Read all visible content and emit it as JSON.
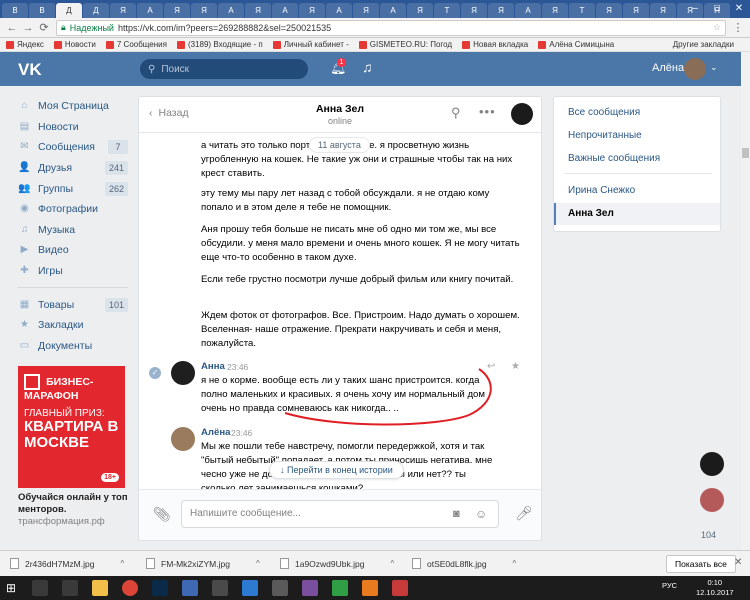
{
  "browser": {
    "tabs": [
      "В",
      "В",
      "Д",
      "Д",
      "Я",
      "А",
      "Я",
      "Я",
      "A",
      "Я",
      "A",
      "Я",
      "A",
      "Я",
      "A",
      "Я",
      "T",
      "Я",
      "Я",
      "A",
      "Я",
      "T",
      "Я",
      "Я",
      "Я",
      "Я",
      "Я"
    ],
    "secure_label": "Надежный",
    "url": "https://vk.com/im?peers=269288882&sel=250021535",
    "bookmarks": [
      "Яндекс",
      "Новости",
      "7 Сообщения",
      "(3189) Входящие - п",
      "Личный кабинет -",
      "GISMETEO.RU: Погод",
      "Новая вкладка",
      "Алёна Симицына"
    ],
    "bookmarks_other": "Другие закладки"
  },
  "header": {
    "logo": "VK",
    "search_placeholder": "Поиск",
    "notifications_count": "1",
    "user_name": "Алёна"
  },
  "sidebar": {
    "items": [
      {
        "label": "Моя Страница",
        "icon": "home-icon",
        "glyph": "⌂",
        "count": ""
      },
      {
        "label": "Новости",
        "icon": "news-icon",
        "glyph": "▤",
        "count": ""
      },
      {
        "label": "Сообщения",
        "icon": "messages-icon",
        "glyph": "✉",
        "count": "7"
      },
      {
        "label": "Друзья",
        "icon": "friends-icon",
        "glyph": "👤",
        "count": "241"
      },
      {
        "label": "Группы",
        "icon": "groups-icon",
        "glyph": "👥",
        "count": "262"
      },
      {
        "label": "Фотографии",
        "icon": "photos-icon",
        "glyph": "◉",
        "count": ""
      },
      {
        "label": "Музыка",
        "icon": "music-icon",
        "glyph": "♫",
        "count": ""
      },
      {
        "label": "Видео",
        "icon": "video-icon",
        "glyph": "▶",
        "count": ""
      },
      {
        "label": "Игры",
        "icon": "games-icon",
        "glyph": "✚",
        "count": ""
      }
    ],
    "items2": [
      {
        "label": "Товары",
        "icon": "goods-icon",
        "glyph": "▦",
        "count": "101"
      },
      {
        "label": "Закладки",
        "icon": "bookmarks-icon",
        "glyph": "★",
        "count": ""
      },
      {
        "label": "Документы",
        "icon": "documents-icon",
        "glyph": "▭",
        "count": ""
      }
    ]
  },
  "ad": {
    "title": "БИЗНЕС-МАРАФОН",
    "prize": "ГЛАВНЫЙ ПРИЗ:",
    "big": "КВАРТИРА В МОСКВЕ",
    "age": "18+",
    "caption": "Обучайся онлайн у топ менторов.",
    "domain": "трансформация.рф"
  },
  "chat": {
    "back_label": "Назад",
    "peer_name": "Анна Зел",
    "peer_status": "online",
    "date_divider": "11 августа",
    "plain_messages": [
      "а читать это только портит настроение. я просветную жизнь угробленную на кошек. Не такие уж они и страшные чтобы так на них крест ставить.",
      "эту тему мы пару лет назад с тобой обсуждали. я не отдаю кому попало и в этом деле я тебе не помощник.",
      "Аня прошу тебя больше не писать мне об одно ми том же, мы все обсудили. у меня мало времени и очень много кошек. Я не могу читать еще что-то особенно в таком духе.",
      "Если тебе грустно посмотри лучше добрый фильм или книгу почитай.",
      "Ждем фоток от фотографов. Все. Пристроим. Надо думать о хорошем. Вселенная- наше отражение. Прекрати накручивать и себя и меня, пожалуйста."
    ],
    "anna_msg": {
      "author": "Анна",
      "time": "23:46",
      "text": "я не о корме. вообще есть ли у таких шанс пристроится. когда полно маленьких и красивых. я очень хочу им нормальный дом очень но правда сомневаюсь как никогда.. .."
    },
    "alena_msg": {
      "author": "Алёна",
      "time": "23:46",
      "text": "Мы же пошли тебе навстречу, помогли передержкой, хотя и так \"бытый небытый\" попадает, а потом ты приносишь негатива. мне чесно уже не до этого... ну какие у них шансы или нет?? ты сколько лет занимаешься кошками?"
    },
    "scroll_to_end": "Перейти в конец истории",
    "compose_placeholder": "Напишите сообщение..."
  },
  "filters": {
    "items": [
      "Все сообщения",
      "Непрочитанные",
      "Важные сообщения"
    ],
    "contacts": [
      "Ирина Снежко"
    ],
    "active": "Анна Зел"
  },
  "floating_count": "104",
  "downloads": {
    "files": [
      "2r436dH7MzM.jpg",
      "FM-Mk2xiZYM.jpg",
      "1a9Ozwd9Ubk.jpg",
      "otSE0dL8flk.jpg"
    ],
    "show_all": "Показать все"
  },
  "taskbar": {
    "lang": "РУС",
    "time": "0:10",
    "date": "12.10.2017"
  },
  "colors": {
    "vk_blue": "#4a76a8",
    "link": "#2a5885",
    "ad_red": "#e2272f",
    "annotation_red": "#e01f25"
  }
}
